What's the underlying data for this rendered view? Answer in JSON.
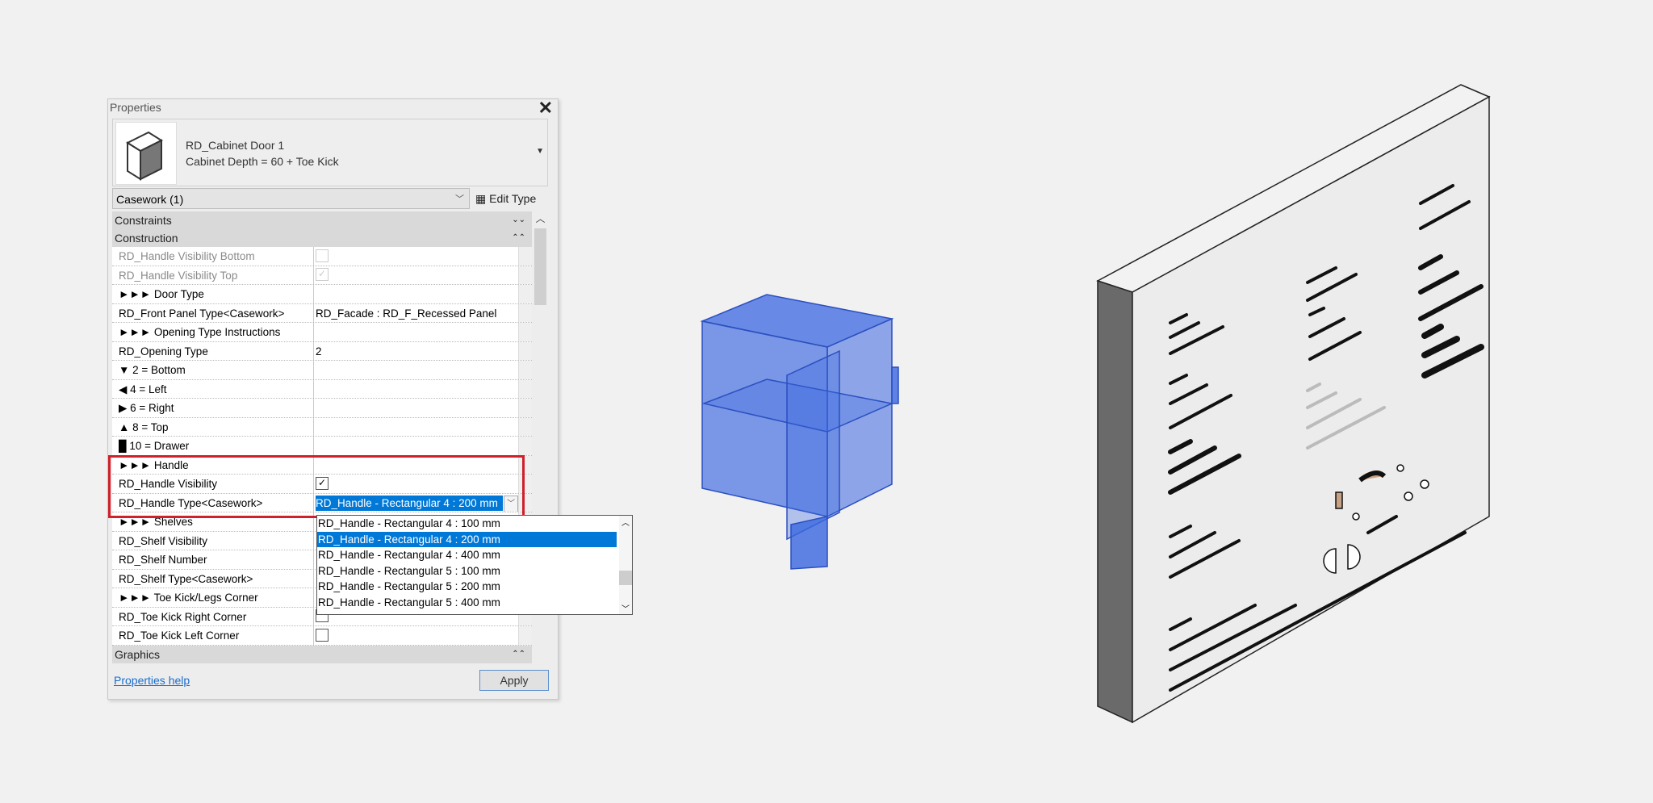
{
  "panel": {
    "title": "Properties",
    "type_name": "RD_Cabinet Door 1",
    "type_subname": "Cabinet Depth = 60 + Toe Kick",
    "category_selector": "Casework (1)",
    "edit_type_label": "Edit Type",
    "help_link": "Properties help",
    "apply_label": "Apply",
    "groups": {
      "constraints": "Constraints",
      "construction": "Construction",
      "graphics": "Graphics"
    },
    "rows": [
      {
        "name": "RD_Handle Visibility Bottom",
        "value": "",
        "checkbox": false,
        "dim": true
      },
      {
        "name": "RD_Handle Visibility Top",
        "value": "",
        "checkbox": true,
        "dim": true
      },
      {
        "name": "►►► Door Type",
        "value": ""
      },
      {
        "name": "RD_Front Panel Type<Casework>",
        "value": "RD_Facade : RD_F_Recessed Panel"
      },
      {
        "name": "►►► Opening Type Instructions",
        "value": ""
      },
      {
        "name": "RD_Opening Type",
        "value": "2"
      },
      {
        "name": "▼ 2 = Bottom",
        "value": ""
      },
      {
        "name": "◀ 4 = Left",
        "value": ""
      },
      {
        "name": "▶ 6 = Right",
        "value": ""
      },
      {
        "name": "▲ 8 = Top",
        "value": ""
      },
      {
        "name": "█ 10 = Drawer",
        "value": ""
      },
      {
        "name": "►►► Handle",
        "value": ""
      },
      {
        "name": "RD_Handle Visibility",
        "value": "",
        "checkbox": true
      },
      {
        "name": "RD_Handle Type<Casework>",
        "value": "RD_Handle - Rectangular 4 : 200 mm"
      },
      {
        "name": "►►► Shelves",
        "value": ""
      },
      {
        "name": "RD_Shelf Visibility",
        "value": ""
      },
      {
        "name": "RD_Shelf Number",
        "value": ""
      },
      {
        "name": "RD_Shelf Type<Casework>",
        "value": ""
      },
      {
        "name": "►►► Toe Kick/Legs Corner",
        "value": ""
      },
      {
        "name": "RD_Toe Kick Right Corner",
        "value": "",
        "checkbox": false
      },
      {
        "name": "RD_Toe Kick Left Corner",
        "value": "",
        "checkbox": false
      }
    ],
    "dropdown_options": [
      "RD_Handle - Rectangular 4 : 100 mm",
      "RD_Handle - Rectangular 4 : 200 mm",
      "RD_Handle - Rectangular 4 : 400 mm",
      "RD_Handle - Rectangular 5 : 100 mm",
      "RD_Handle - Rectangular 5 : 200 mm",
      "RD_Handle - Rectangular 5 : 400 mm"
    ],
    "dropdown_selected_index": 1
  },
  "colors": {
    "selection": "#0078d7",
    "highlight_box": "#d0202a",
    "cabinet": "#3a66e0",
    "link": "#1a6ecc"
  }
}
